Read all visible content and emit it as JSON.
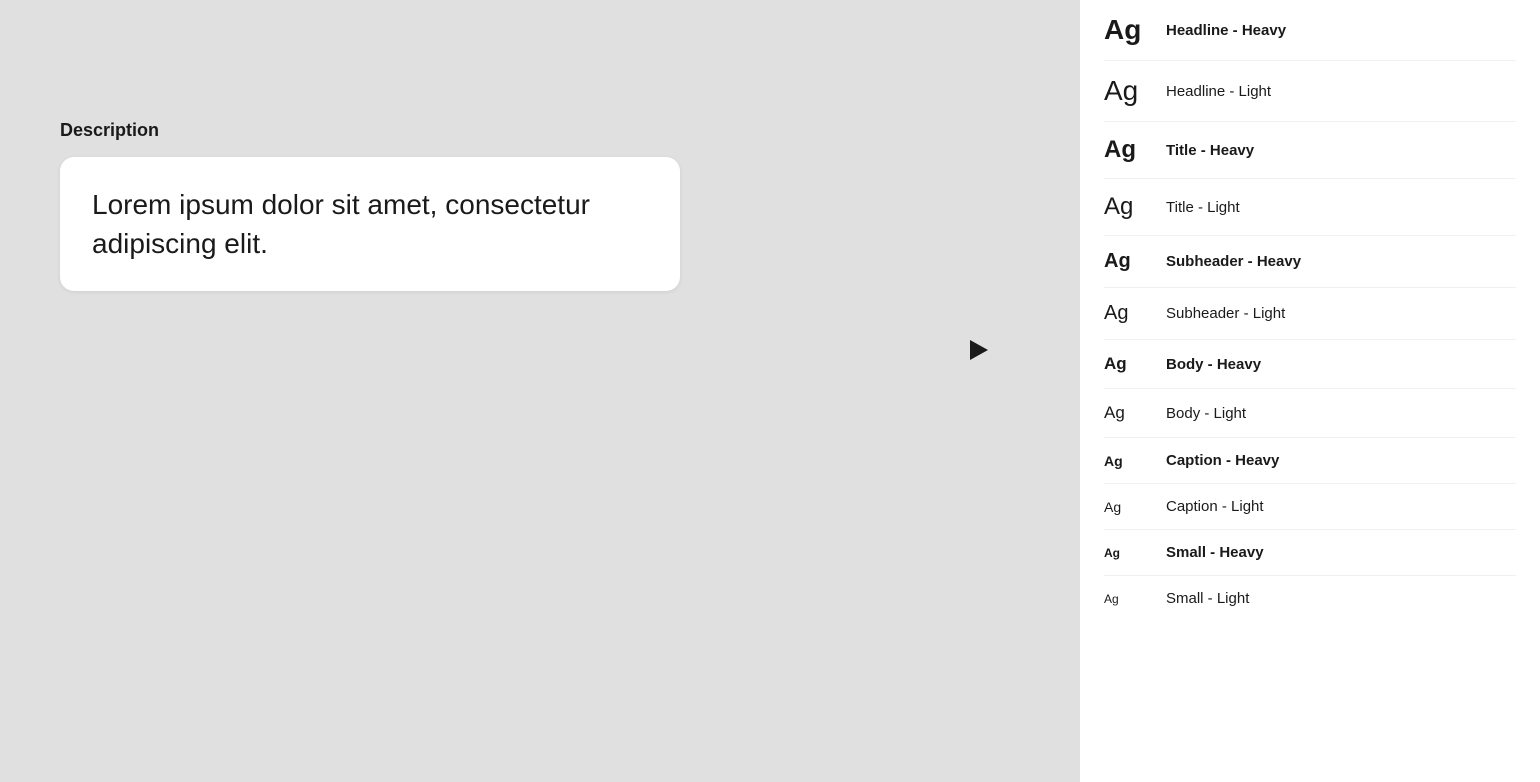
{
  "main": {
    "description_label": "Description",
    "description_text": "Lorem ipsum dolor sit amet, consectetur adipiscing elit."
  },
  "sidebar": {
    "items": [
      {
        "id": "headline-heavy",
        "ag_class": "ag-headline-heavy",
        "label": "Headline - Heavy",
        "label_weight": "heavy"
      },
      {
        "id": "headline-light",
        "ag_class": "ag-headline-light",
        "label": "Headline - Light",
        "label_weight": "light"
      },
      {
        "id": "title-heavy",
        "ag_class": "ag-title-heavy",
        "label": "Title - Heavy",
        "label_weight": "heavy"
      },
      {
        "id": "title-light",
        "ag_class": "ag-title-light",
        "label": "Title - Light",
        "label_weight": "light"
      },
      {
        "id": "subheader-heavy",
        "ag_class": "ag-subheader-heavy",
        "label": "Subheader - Heavy",
        "label_weight": "heavy"
      },
      {
        "id": "subheader-light",
        "ag_class": "ag-subheader-light",
        "label": "Subheader - Light",
        "label_weight": "light"
      },
      {
        "id": "body-heavy",
        "ag_class": "ag-body-heavy",
        "label": "Body - Heavy",
        "label_weight": "heavy"
      },
      {
        "id": "body-light",
        "ag_class": "ag-body-light",
        "label": "Body - Light",
        "label_weight": "light"
      },
      {
        "id": "caption-heavy",
        "ag_class": "ag-caption-heavy",
        "label": "Caption - Heavy",
        "label_weight": "heavy"
      },
      {
        "id": "caption-light",
        "ag_class": "ag-caption-light",
        "label": "Caption - Light",
        "label_weight": "light"
      },
      {
        "id": "small-heavy",
        "ag_class": "ag-small-heavy",
        "label": "Small - Heavy",
        "label_weight": "heavy"
      },
      {
        "id": "small-light",
        "ag_class": "ag-small-light",
        "label": "Small - Light",
        "label_weight": "light"
      }
    ]
  }
}
